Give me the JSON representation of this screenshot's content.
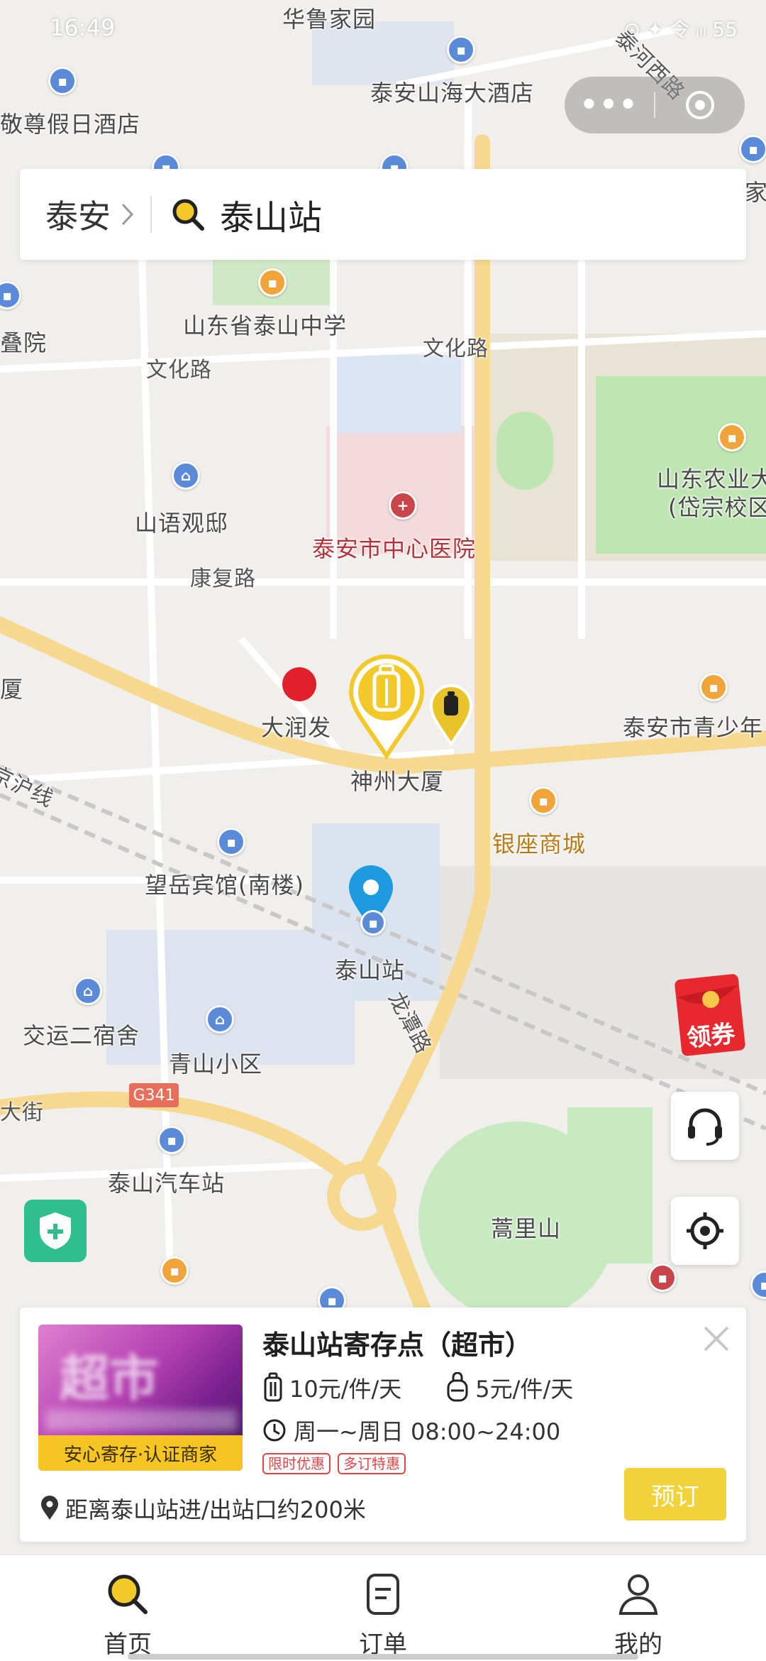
{
  "status_bar": {
    "time": "16:49",
    "right": "⊙ ✦ 令 ᵢₗₗ 55"
  },
  "capsule": {
    "more": "•••"
  },
  "search": {
    "city": "泰安",
    "query": "泰山站"
  },
  "map": {
    "labels": {
      "hualu": "华鲁家园",
      "haida": "泰安山海大酒店",
      "jiari": "敬尊假日酒店",
      "taihe": "泰河西路",
      "jia": "家",
      "yuan": "叠院",
      "zhongxue": "山东省泰山中学",
      "wenhua1": "文化路",
      "wenhua2": "文化路",
      "nongye1": "山东农业大",
      "nongye2": "(岱宗校区",
      "shanyu": "山语观邸",
      "hospital": "泰安市中心医院",
      "kangfu": "康复路",
      "sha": "厦",
      "runfa": "大润发",
      "shenzhou": "神州大厦",
      "qingshao": "泰安市青少年",
      "jinghu": "京沪线",
      "yinzuo": "银座商城",
      "wangyue": "望岳宾馆(南楼)",
      "taishanzhan": "泰山站",
      "longtan": "龙潭路",
      "jiaoyun": "交运二宿舍",
      "qingshan": "青山小区",
      "dajie": "大街",
      "g341": "G341",
      "qiche": "泰山汽车站",
      "haolishan": "蒿里山"
    }
  },
  "buttons": {
    "coupon": "领券"
  },
  "store": {
    "title": "泰山站寄存点（超市）",
    "thumb_text": "超市",
    "badge": "安心寄存·认证商家",
    "price_large": "10元/件/天",
    "price_small": "5元/件/天",
    "hours": "周一~周日 08:00~24:00",
    "tags": [
      "限时优惠",
      "多订特惠"
    ],
    "distance": "距离泰山站进/出站口约200米",
    "book": "预订"
  },
  "nav": [
    {
      "label": "首页",
      "icon": "search-icon"
    },
    {
      "label": "订单",
      "icon": "order-icon"
    },
    {
      "label": "我的",
      "icon": "user-icon"
    }
  ],
  "colors": {
    "accent": "#f2d23a",
    "road_major": "#f7d98a",
    "location_blue": "#1e9be0",
    "safe_green": "#2fbf8f"
  }
}
